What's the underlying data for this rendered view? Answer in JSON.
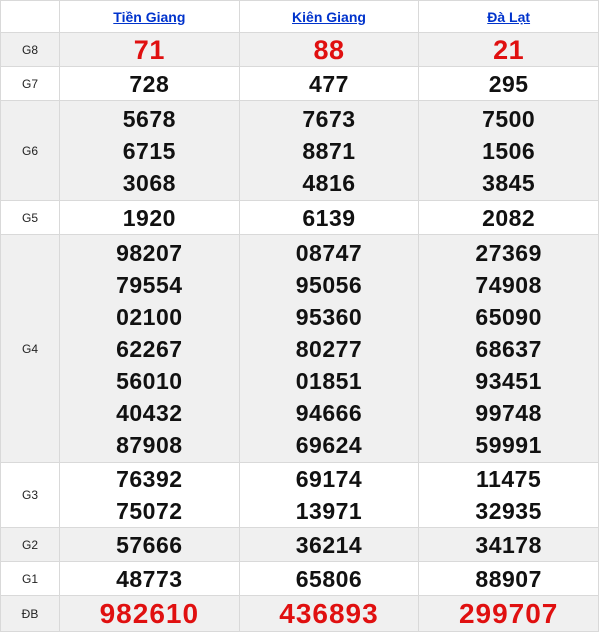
{
  "provinces": [
    "Tiền Giang",
    "Kiên Giang",
    "Đà Lạt"
  ],
  "prizes": {
    "g8": {
      "label": "G8",
      "values": [
        [
          "71"
        ],
        [
          "88"
        ],
        [
          "21"
        ]
      ]
    },
    "g7": {
      "label": "G7",
      "values": [
        [
          "728"
        ],
        [
          "477"
        ],
        [
          "295"
        ]
      ]
    },
    "g6": {
      "label": "G6",
      "values": [
        [
          "5678",
          "6715",
          "3068"
        ],
        [
          "7673",
          "8871",
          "4816"
        ],
        [
          "7500",
          "1506",
          "3845"
        ]
      ]
    },
    "g5": {
      "label": "G5",
      "values": [
        [
          "1920"
        ],
        [
          "6139"
        ],
        [
          "2082"
        ]
      ]
    },
    "g4": {
      "label": "G4",
      "values": [
        [
          "98207",
          "79554",
          "02100",
          "62267",
          "56010",
          "40432",
          "87908"
        ],
        [
          "08747",
          "95056",
          "95360",
          "80277",
          "01851",
          "94666",
          "69624"
        ],
        [
          "27369",
          "74908",
          "65090",
          "68637",
          "93451",
          "99748",
          "59991"
        ]
      ]
    },
    "g3": {
      "label": "G3",
      "values": [
        [
          "76392",
          "75072"
        ],
        [
          "69174",
          "13971"
        ],
        [
          "11475",
          "32935"
        ]
      ]
    },
    "g2": {
      "label": "G2",
      "values": [
        [
          "57666"
        ],
        [
          "36214"
        ],
        [
          "34178"
        ]
      ]
    },
    "g1": {
      "label": "G1",
      "values": [
        [
          "48773"
        ],
        [
          "65806"
        ],
        [
          "88907"
        ]
      ]
    },
    "db": {
      "label": "ĐB",
      "values": [
        [
          "982610"
        ],
        [
          "436893"
        ],
        [
          "299707"
        ]
      ]
    }
  },
  "colors": {
    "prize_red": "#e01010",
    "link_blue": "#0033cc",
    "alt_row": "#f0f0f0"
  }
}
